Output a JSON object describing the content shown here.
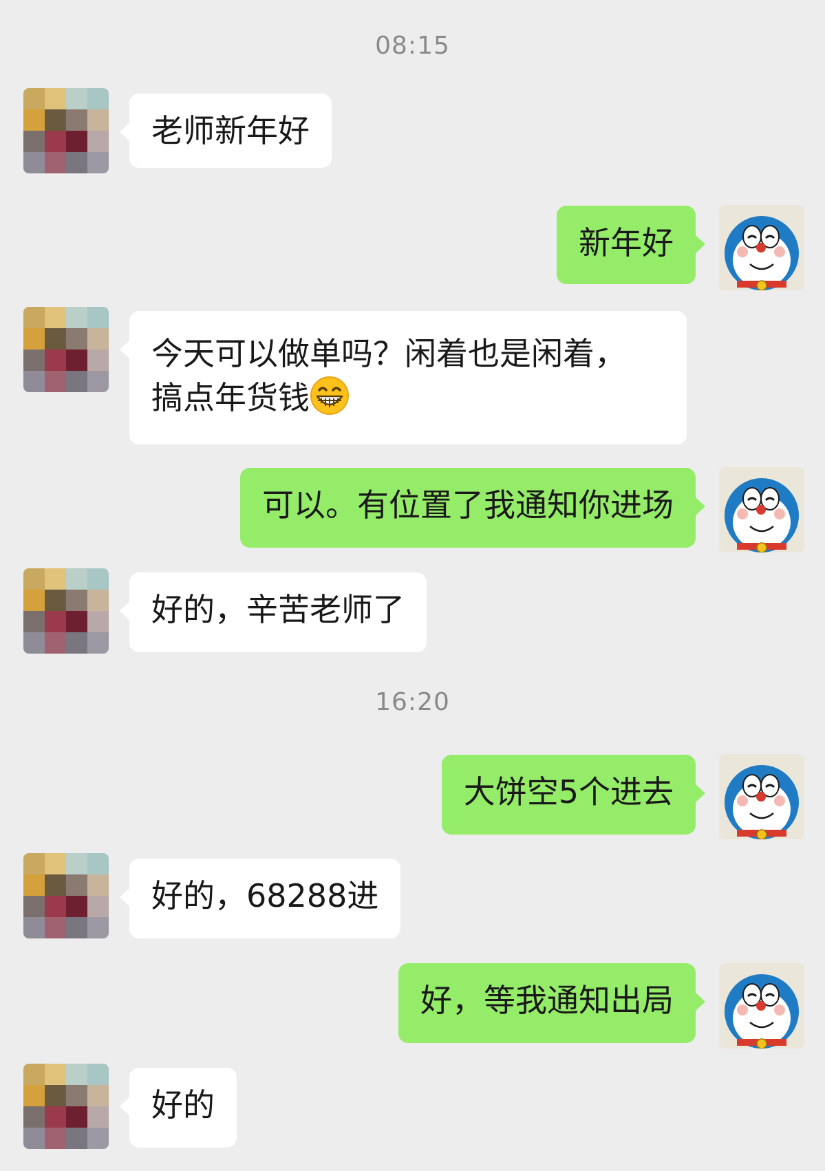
{
  "timestamps": [
    "08:15",
    "16:20"
  ],
  "messages": [
    {
      "side": "in",
      "text": "老师新年好"
    },
    {
      "side": "out",
      "text": "新年好"
    },
    {
      "side": "in",
      "text_line1": "今天可以做单吗？闲着也是闲着，",
      "text_line2": "搞点年货钱",
      "emoji": "grinning-face-emoji"
    },
    {
      "side": "out",
      "text": "可以。有位置了我通知你进场"
    },
    {
      "side": "in",
      "text": "好的，辛苦老师了"
    },
    {
      "side": "out",
      "text": "大饼空5个进去"
    },
    {
      "side": "in",
      "text": "好的，68288进"
    },
    {
      "side": "out",
      "text": "好，等我通知出局"
    },
    {
      "side": "in",
      "text": "好的"
    }
  ],
  "colors": {
    "background": "#ededed",
    "incoming_bubble": "#ffffff",
    "outgoing_bubble": "#95ec69",
    "timestamp_text": "#8a8a8a"
  },
  "avatars": {
    "contact": "pixelated-avatar",
    "self": "doraemon-avatar"
  }
}
